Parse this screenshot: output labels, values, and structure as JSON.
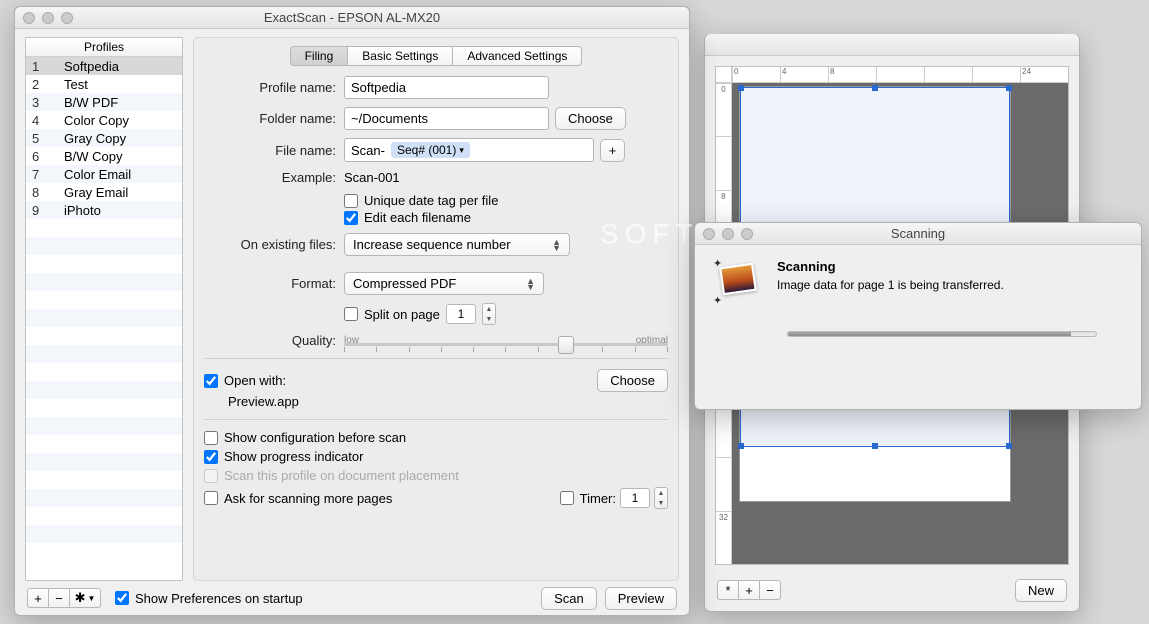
{
  "main": {
    "title": "ExactScan - EPSON AL-MX20",
    "profilesHeader": "Profiles",
    "profiles": [
      {
        "num": "1",
        "name": "Softpedia"
      },
      {
        "num": "2",
        "name": "Test"
      },
      {
        "num": "3",
        "name": "B/W PDF"
      },
      {
        "num": "4",
        "name": "Color Copy"
      },
      {
        "num": "5",
        "name": "Gray Copy"
      },
      {
        "num": "6",
        "name": "B/W Copy"
      },
      {
        "num": "7",
        "name": "Color Email"
      },
      {
        "num": "8",
        "name": "Gray Email"
      },
      {
        "num": "9",
        "name": "iPhoto"
      }
    ],
    "tabs": {
      "filing": "Filing",
      "basic": "Basic Settings",
      "advanced": "Advanced Settings"
    },
    "labels": {
      "profileName": "Profile name:",
      "folderName": "Folder name:",
      "fileName": "File name:",
      "example": "Example:",
      "onExisting": "On existing files:",
      "format": "Format:",
      "quality": "Quality:",
      "openWith": "Open with:",
      "sliderLow": "low",
      "sliderOptimal": "optimal"
    },
    "values": {
      "profileName": "Softpedia",
      "folderName": "~/Documents",
      "fileNamePrefix": "Scan-",
      "fileNameToken": "Seq# (001)",
      "exampleValue": "Scan-001",
      "onExisting": "Increase sequence number",
      "format": "Compressed PDF",
      "splitPage": "1",
      "openWithApp": "Preview.app",
      "timerValue": "1"
    },
    "checks": {
      "uniqueDate": "Unique date tag per file",
      "editEach": "Edit each filename",
      "splitOnPage": "Split on page",
      "showConfig": "Show configuration before scan",
      "showProgress": "Show progress indicator",
      "scanOnPlacement": "Scan this profile on document placement",
      "askMore": "Ask for scanning more pages",
      "timer": "Timer:",
      "showPrefs": "Show Preferences on startup"
    },
    "buttons": {
      "choose": "Choose",
      "plus": "+",
      "scan": "Scan",
      "preview": "Preview"
    },
    "toolbar": {
      "add": "+",
      "remove": "−",
      "gear": "✱▾"
    }
  },
  "preview": {
    "rulerH": [
      "0",
      "4",
      "8",
      "",
      "",
      "",
      "24"
    ],
    "rulerV": [
      "0",
      "",
      "8",
      "",
      "",
      "",
      "",
      "",
      "32"
    ],
    "buttons": {
      "star": "*",
      "add": "+",
      "remove": "−",
      "new": "New"
    }
  },
  "scanning": {
    "title": "Scanning",
    "heading": "Scanning",
    "message": "Image data for page 1 is being transferred."
  },
  "watermark": "SOFTPEDIA"
}
